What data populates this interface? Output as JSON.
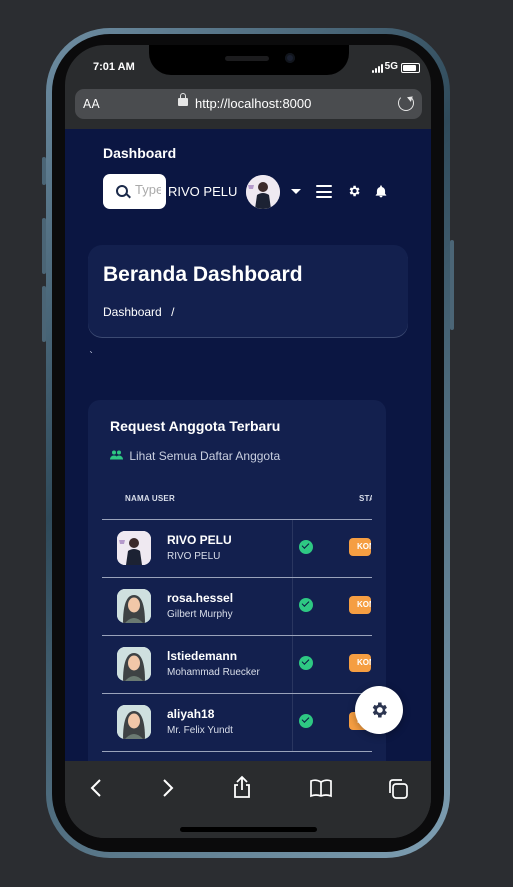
{
  "status_bar": {
    "time": "7:01 AM",
    "network": "5G"
  },
  "browser": {
    "aa_label": "AA",
    "url": "http://localhost:8000"
  },
  "header": {
    "brand": "Dashboard",
    "search_placeholder": "Type",
    "user_name": "RIVO PELU"
  },
  "page_header": {
    "title": "Beranda Dashboard",
    "breadcrumb": "Dashboard",
    "breadcrumb_separator": "/",
    "stray_mark": "`"
  },
  "requests_card": {
    "title": "Request Anggota Terbaru",
    "link": "Lihat Semua Daftar Anggota",
    "columns": [
      "NAMA USER",
      "STATUS"
    ],
    "rows": [
      {
        "username": "RIVO PELU",
        "full_name": "RIVO PELU",
        "status": "KONFIRMASI",
        "avatar": "photo"
      },
      {
        "username": "rosa.hessel",
        "full_name": "Gilbert Murphy",
        "status": "KONFIRMASI",
        "avatar": "woman"
      },
      {
        "username": "lstiedemann",
        "full_name": "Mohammad Ruecker",
        "status": "KONFIRMASI",
        "avatar": "woman"
      },
      {
        "username": "aliyah18",
        "full_name": "Mr. Felix Yundt",
        "status": "KONFIRMASI",
        "avatar": "woman"
      }
    ]
  },
  "colors": {
    "page_bg": "#0b1642",
    "card_bg": "#13204e",
    "accent_green": "#2ec883",
    "badge_orange": "#f59e42"
  }
}
